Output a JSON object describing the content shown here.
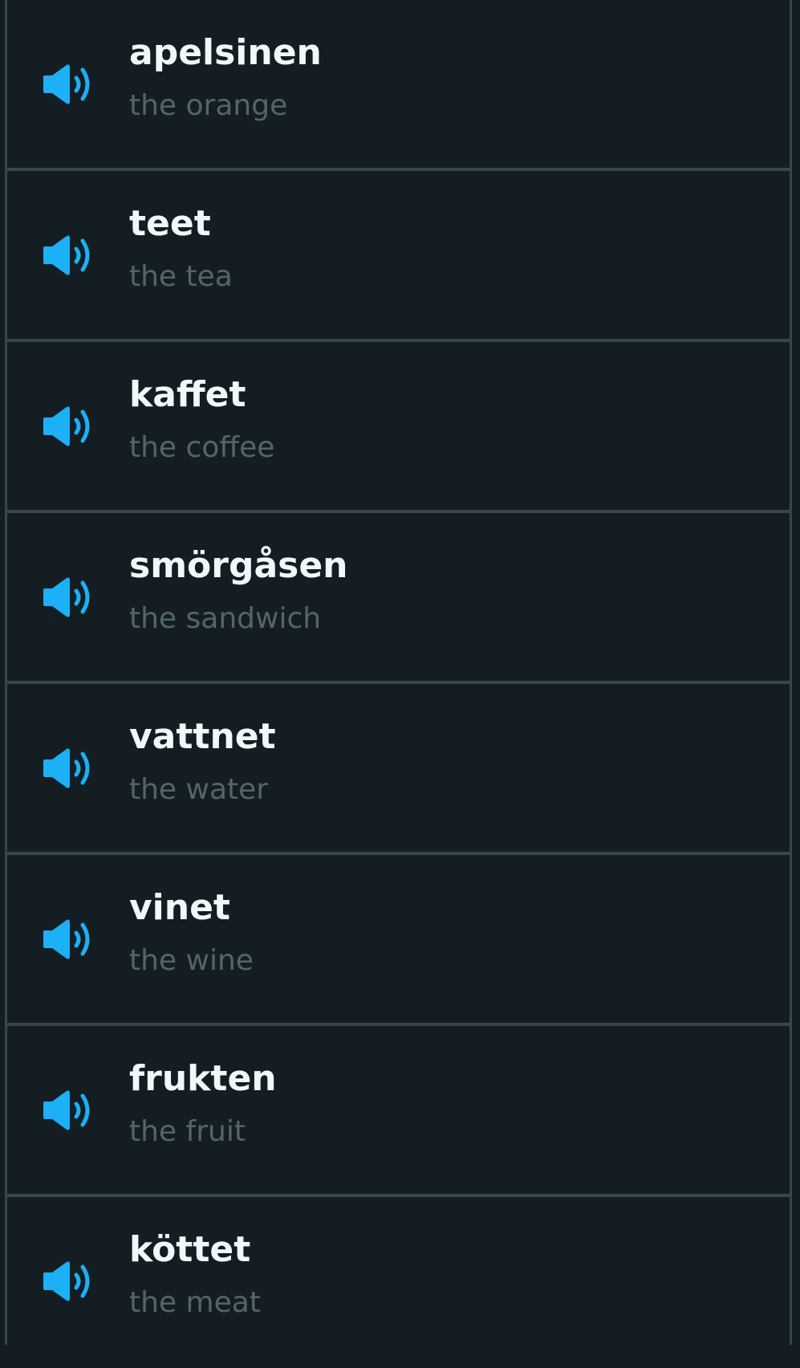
{
  "colors": {
    "background": "#141d22",
    "border": "#37464f",
    "word_text": "#f1f7fb",
    "translation_text": "#52656d",
    "speaker_icon": "#1cb0f6"
  },
  "vocab_list": {
    "items": [
      {
        "word": "apelsinen",
        "translation": "the orange",
        "icon": "speaker-icon"
      },
      {
        "word": "teet",
        "translation": "the tea",
        "icon": "speaker-icon"
      },
      {
        "word": "kaffet",
        "translation": "the coffee",
        "icon": "speaker-icon"
      },
      {
        "word": "smörgåsen",
        "translation": "the sandwich",
        "icon": "speaker-icon"
      },
      {
        "word": "vattnet",
        "translation": "the water",
        "icon": "speaker-icon"
      },
      {
        "word": "vinet",
        "translation": "the wine",
        "icon": "speaker-icon"
      },
      {
        "word": "frukten",
        "translation": "the fruit",
        "icon": "speaker-icon"
      },
      {
        "word": "köttet",
        "translation": "the meat",
        "icon": "speaker-icon"
      }
    ]
  }
}
